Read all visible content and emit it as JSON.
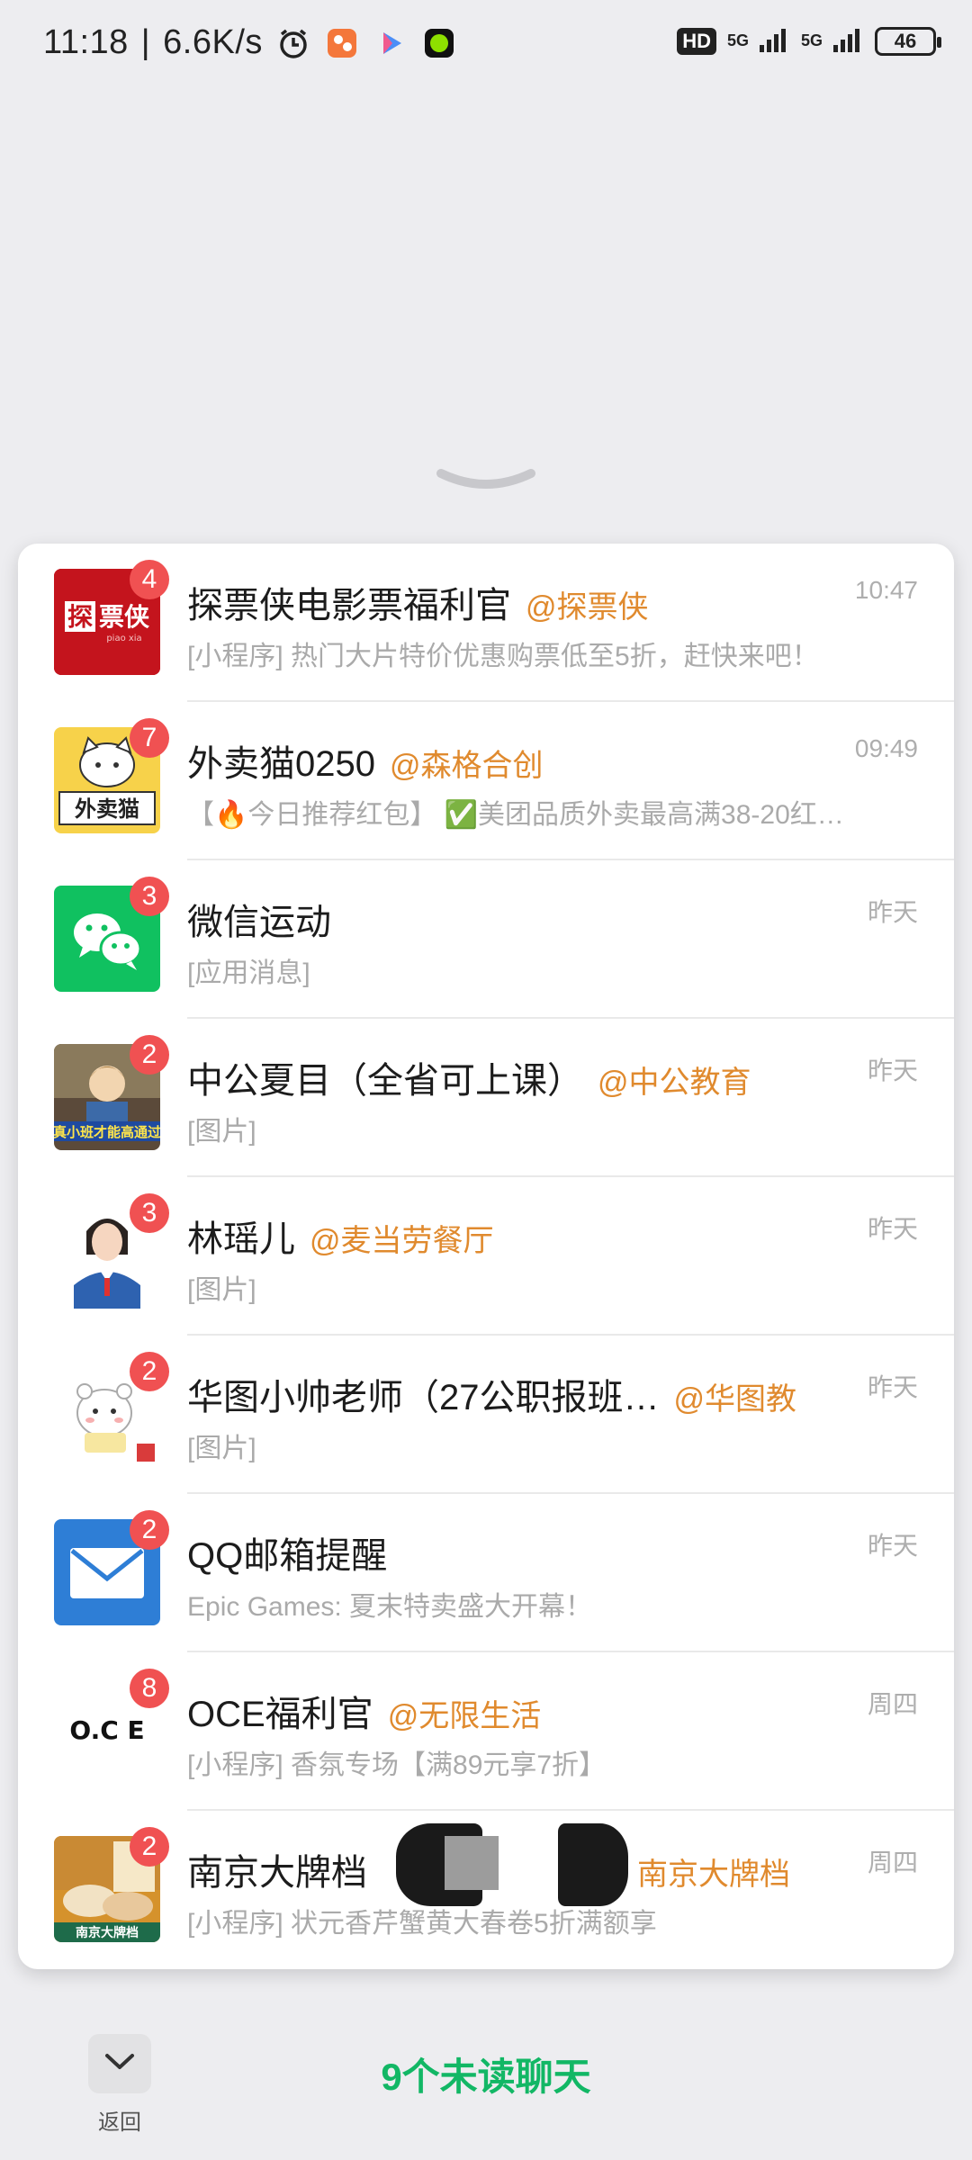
{
  "status_bar": {
    "time": "11:18",
    "speed": "6.6K/s",
    "net1": "5G",
    "net2": "5G",
    "hd": "HD",
    "battery": "46"
  },
  "chats": [
    {
      "title": "探票侠电影票福利官",
      "org": "@探票侠",
      "time": "10:47",
      "preview": "[小程序] 热门大片特价优惠购票低至5折，赶快来吧！",
      "badge": "4",
      "avatar_text": "探票侠",
      "avatar_color": "#c4141d"
    },
    {
      "title": "外卖猫0250",
      "org": "@森格合创",
      "time": "09:49",
      "preview": "【🔥今日推荐红包】 ✅美团品质外卖最高满38-20红…",
      "badge": "7",
      "avatar_text": "外卖猫",
      "avatar_color": "#f7d24a"
    },
    {
      "title": "微信运动",
      "org": "",
      "time": "昨天",
      "preview": "[应用消息]",
      "badge": "3",
      "avatar_text": "",
      "avatar_color": "#10c160"
    },
    {
      "title": "中公夏目（全省可上课）",
      "org": "@中公教育",
      "time": "昨天",
      "preview": "[图片]",
      "badge": "2",
      "avatar_text": "真小班才能高通过",
      "avatar_color": "#3b6aa8"
    },
    {
      "title": "林瑶儿",
      "org": "@麦当劳餐厅",
      "time": "昨天",
      "preview": "[图片]",
      "badge": "3",
      "avatar_text": "",
      "avatar_color": "#2e62b0"
    },
    {
      "title": "华图小帅老师（27公职报班…",
      "org": "@华图教",
      "time": "昨天",
      "preview": "[图片]",
      "badge": "2",
      "avatar_text": "",
      "avatar_color": "#ffffff"
    },
    {
      "title": "QQ邮箱提醒",
      "org": "",
      "time": "昨天",
      "preview": "Epic Games: 夏末特卖盛大开幕！",
      "badge": "2",
      "avatar_text": "",
      "avatar_color": "#2e7ed6"
    },
    {
      "title": "OCE福利官",
      "org": "@无限生活",
      "time": "周四",
      "preview": "[小程序] 香氛专场【满89元享7折】",
      "badge": "8",
      "avatar_text": "O.C E",
      "avatar_color": "#ffffff"
    },
    {
      "title": "南京大牌档",
      "org": "南京大牌档",
      "time": "周四",
      "preview": "[小程序] 状元香芹蟹黄大春卷5折满额享",
      "badge": "2",
      "avatar_text": "南京大牌档",
      "avatar_color": "#d5922c"
    }
  ],
  "bottom": {
    "back_label": "返回",
    "unread_label": "9个未读聊天"
  },
  "colors": {
    "badge": "#f05152",
    "org": "#e08a2e",
    "unread": "#12b765"
  }
}
